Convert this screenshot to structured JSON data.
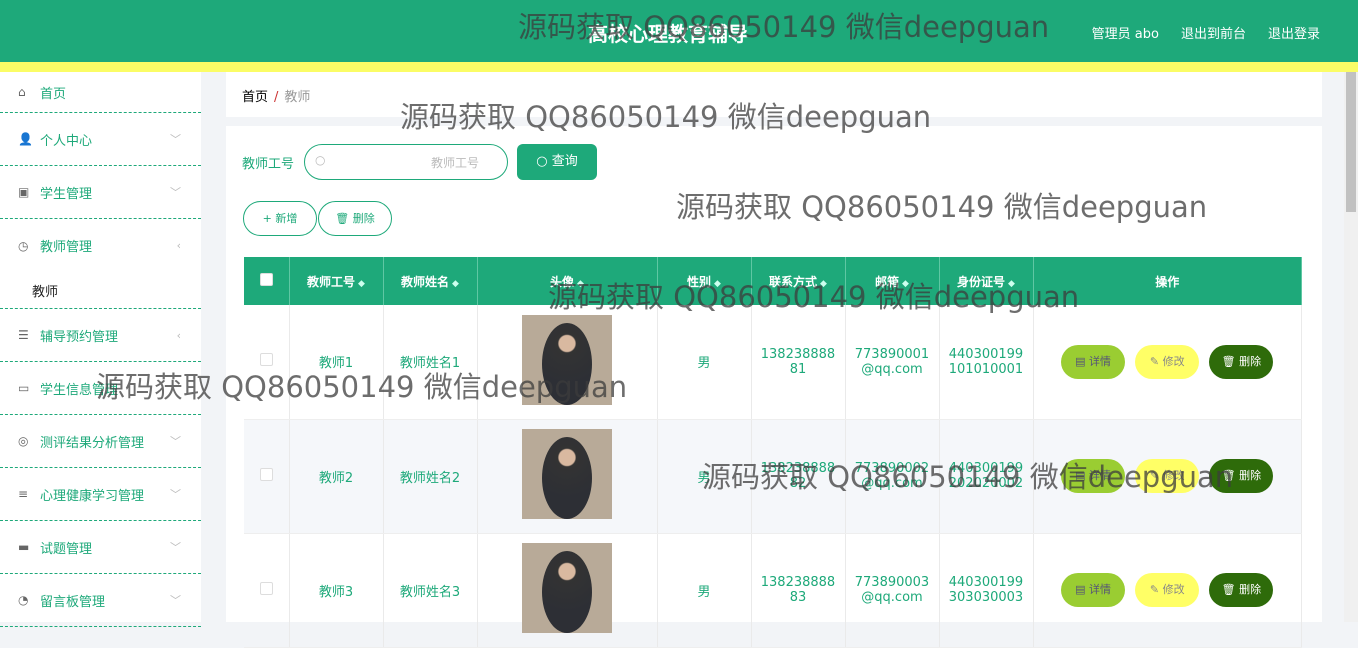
{
  "header": {
    "title": "高校心理教育辅导",
    "links": [
      "管理员 abo",
      "退出到前台",
      "退出登录"
    ]
  },
  "sidebar": {
    "items": [
      {
        "label": "首页",
        "icon": "home-icon",
        "glyph": "⌂",
        "chevron": ""
      },
      {
        "label": "个人中心",
        "icon": "user-icon",
        "glyph": "👤",
        "chevron": "﹀"
      },
      {
        "label": "学生管理",
        "icon": "clipboard-icon",
        "glyph": "▣",
        "chevron": "﹀"
      },
      {
        "label": "教师管理",
        "icon": "gauge-icon",
        "glyph": "◷",
        "chevron": "‹"
      },
      {
        "label": "辅导预约管理",
        "icon": "sliders-icon",
        "glyph": "☰",
        "chevron": "‹"
      },
      {
        "label": "学生信息管理",
        "icon": "chat-icon",
        "glyph": "▭",
        "chevron": ""
      },
      {
        "label": "测评结果分析管理",
        "icon": "compass-icon",
        "glyph": "◎",
        "chevron": "﹀"
      },
      {
        "label": "心理健康学习管理",
        "icon": "list-icon",
        "glyph": "≡",
        "chevron": "﹀"
      },
      {
        "label": "试题管理",
        "icon": "monitor-icon",
        "glyph": "▬",
        "chevron": "﹀"
      },
      {
        "label": "留言板管理",
        "icon": "clock-icon",
        "glyph": "◔",
        "chevron": "﹀"
      }
    ],
    "sub": "教师"
  },
  "breadcrumb": {
    "home": "首页",
    "sep": "/",
    "current": "教师"
  },
  "search": {
    "label": "教师工号",
    "placeholder": "教师工号",
    "query": "查询"
  },
  "actions": {
    "add": "+ 新增",
    "delete": "🗑 删除"
  },
  "table": {
    "headers": [
      "教师工号",
      "教师姓名",
      "头像",
      "性别",
      "联系方式",
      "邮箱",
      "身份证号",
      "操作"
    ],
    "rows": [
      {
        "id": "教师1",
        "name": "教师姓名1",
        "gender": "男",
        "phone": "13823888881",
        "email": "773890001@qq.com",
        "idcard": "440300199101010001"
      },
      {
        "id": "教师2",
        "name": "教师姓名2",
        "gender": "男",
        "phone": "13823888882",
        "email": "773890002@qq.com",
        "idcard": "440300199202020002"
      },
      {
        "id": "教师3",
        "name": "教师姓名3",
        "gender": "男",
        "phone": "13823888883",
        "email": "773890003@qq.com",
        "idcard": "440300199303030003"
      }
    ],
    "buttons": {
      "detail": "详情",
      "edit": "修改",
      "delete": "删除"
    }
  },
  "colors": {
    "primary": "#1ea97a",
    "accent": "#fbfd66",
    "detail": "#9acd32",
    "edit": "#ffff66",
    "delete": "#2e6b0a"
  },
  "watermark": "源码获取 QQ86050149 微信deepguan"
}
